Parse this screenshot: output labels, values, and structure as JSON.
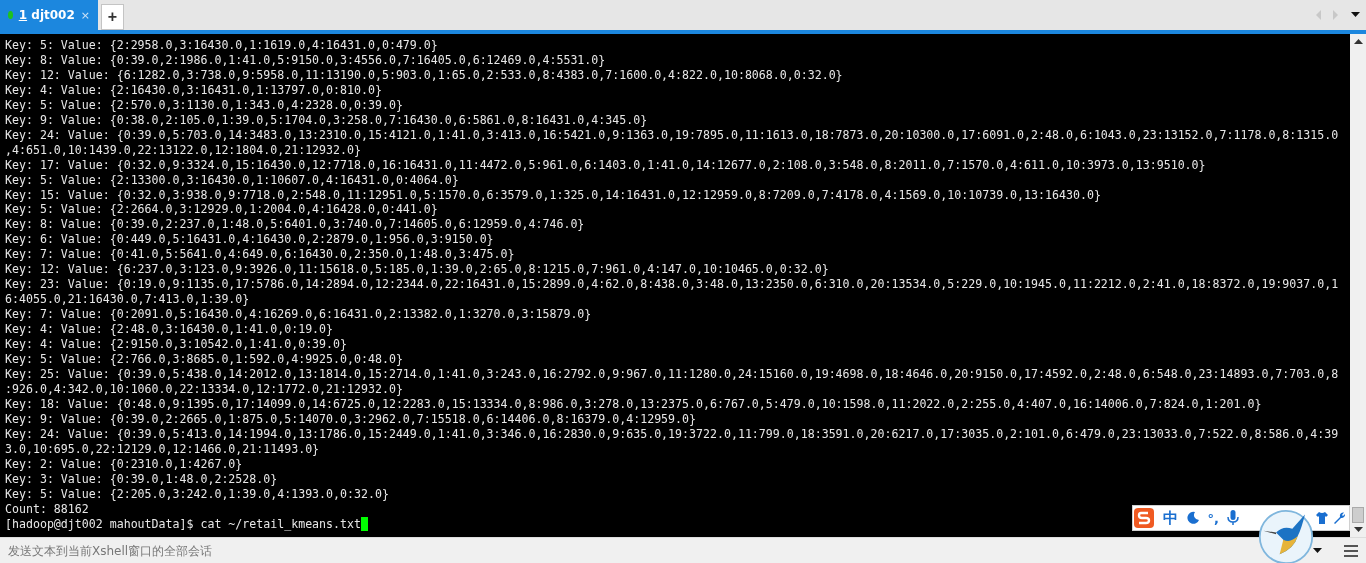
{
  "tabs": [
    {
      "number": "1",
      "label": "djt002",
      "selected": true,
      "close": "×"
    }
  ],
  "new_tab": "+",
  "terminal": {
    "lines": [
      "Key: 5: Value: {2:2958.0,3:16430.0,1:1619.0,4:16431.0,0:479.0}",
      "Key: 8: Value: {0:39.0,2:1986.0,1:41.0,5:9150.0,3:4556.0,7:16405.0,6:12469.0,4:5531.0}",
      "Key: 12: Value: {6:1282.0,3:738.0,9:5958.0,11:13190.0,5:903.0,1:65.0,2:533.0,8:4383.0,7:1600.0,4:822.0,10:8068.0,0:32.0}",
      "Key: 4: Value: {2:16430.0,3:16431.0,1:13797.0,0:810.0}",
      "Key: 5: Value: {2:570.0,3:1130.0,1:343.0,4:2328.0,0:39.0}",
      "Key: 9: Value: {0:38.0,2:105.0,1:39.0,5:1704.0,3:258.0,7:16430.0,6:5861.0,8:16431.0,4:345.0}",
      "Key: 24: Value: {0:39.0,5:703.0,14:3483.0,13:2310.0,15:4121.0,1:41.0,3:413.0,16:5421.0,9:1363.0,19:7895.0,11:1613.0,18:7873.0,20:10300.0,17:6091.0,2:48.0,6:1043.0,23:13152.0,7:1178.0,8:1315.0",
      ",4:651.0,10:1439.0,22:13122.0,12:1804.0,21:12932.0}",
      "Key: 17: Value: {0:32.0,9:3324.0,15:16430.0,12:7718.0,16:16431.0,11:4472.0,5:961.0,6:1403.0,1:41.0,14:12677.0,2:108.0,3:548.0,8:2011.0,7:1570.0,4:611.0,10:3973.0,13:9510.0}",
      "Key: 5: Value: {2:13300.0,3:16430.0,1:10607.0,4:16431.0,0:4064.0}",
      "Key: 15: Value: {0:32.0,3:938.0,9:7718.0,2:548.0,11:12951.0,5:1570.0,6:3579.0,1:325.0,14:16431.0,12:12959.0,8:7209.0,7:4178.0,4:1569.0,10:10739.0,13:16430.0}",
      "Key: 5: Value: {2:2664.0,3:12929.0,1:2004.0,4:16428.0,0:441.0}",
      "Key: 8: Value: {0:39.0,2:237.0,1:48.0,5:6401.0,3:740.0,7:14605.0,6:12959.0,4:746.0}",
      "Key: 6: Value: {0:449.0,5:16431.0,4:16430.0,2:2879.0,1:956.0,3:9150.0}",
      "Key: 7: Value: {0:41.0,5:5641.0,4:649.0,6:16430.0,2:350.0,1:48.0,3:475.0}",
      "Key: 12: Value: {6:237.0,3:123.0,9:3926.0,11:15618.0,5:185.0,1:39.0,2:65.0,8:1215.0,7:961.0,4:147.0,10:10465.0,0:32.0}",
      "Key: 23: Value: {0:19.0,9:1135.0,17:5786.0,14:2894.0,12:2344.0,22:16431.0,15:2899.0,4:62.0,8:438.0,3:48.0,13:2350.0,6:310.0,20:13534.0,5:229.0,10:1945.0,11:2212.0,2:41.0,18:8372.0,19:9037.0,1",
      "6:4055.0,21:16430.0,7:413.0,1:39.0}",
      "Key: 7: Value: {0:2091.0,5:16430.0,4:16269.0,6:16431.0,2:13382.0,1:3270.0,3:15879.0}",
      "Key: 4: Value: {2:48.0,3:16430.0,1:41.0,0:19.0}",
      "Key: 4: Value: {2:9150.0,3:10542.0,1:41.0,0:39.0}",
      "Key: 5: Value: {2:766.0,3:8685.0,1:592.0,4:9925.0,0:48.0}",
      "Key: 25: Value: {0:39.0,5:438.0,14:2012.0,13:1814.0,15:2714.0,1:41.0,3:243.0,16:2792.0,9:967.0,11:1280.0,24:15160.0,19:4698.0,18:4646.0,20:9150.0,17:4592.0,2:48.0,6:548.0,23:14893.0,7:703.0,8",
      ":926.0,4:342.0,10:1060.0,22:13334.0,12:1772.0,21:12932.0}",
      "Key: 18: Value: {0:48.0,9:1395.0,17:14099.0,14:6725.0,12:2283.0,15:13334.0,8:986.0,3:278.0,13:2375.0,6:767.0,5:479.0,10:1598.0,11:2022.0,2:255.0,4:407.0,16:14006.0,7:824.0,1:201.0}",
      "Key: 9: Value: {0:39.0,2:2665.0,1:875.0,5:14070.0,3:2962.0,7:15518.0,6:14406.0,8:16379.0,4:12959.0}",
      "Key: 24: Value: {0:39.0,5:413.0,14:1994.0,13:1786.0,15:2449.0,1:41.0,3:346.0,16:2830.0,9:635.0,19:3722.0,11:799.0,18:3591.0,20:6217.0,17:3035.0,2:101.0,6:479.0,23:13033.0,7:522.0,8:586.0,4:39",
      "3.0,10:695.0,22:12129.0,12:1466.0,21:11493.0}",
      "Key: 2: Value: {0:2310.0,1:4267.0}",
      "Key: 3: Value: {0:39.0,1:48.0,2:2528.0}",
      "Key: 5: Value: {2:205.0,3:242.0,1:39.0,4:1393.0,0:32.0}",
      "Count: 88162"
    ],
    "prompt": "[hadoop@djt002 mahoutData]$ cat ~/retail_kmeans.txt"
  },
  "send_bar": {
    "placeholder": "发送文本到当前Xshell窗口的全部会话"
  },
  "ime_toolbar": {
    "mode": "中",
    "punctuation": "°,"
  }
}
